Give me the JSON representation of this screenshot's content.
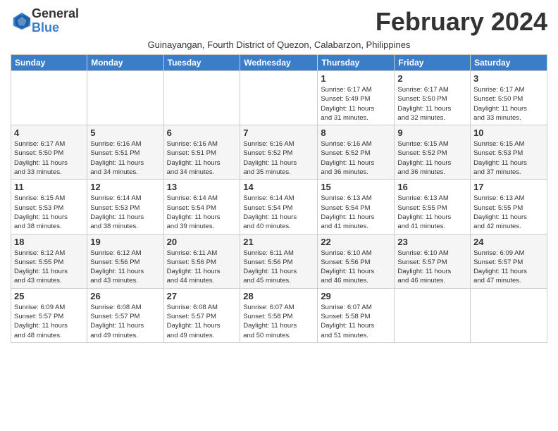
{
  "logo": {
    "general": "General",
    "blue": "Blue"
  },
  "title": "February 2024",
  "subtitle": "Guinayangan, Fourth District of Quezon, Calabarzon, Philippines",
  "days_of_week": [
    "Sunday",
    "Monday",
    "Tuesday",
    "Wednesday",
    "Thursday",
    "Friday",
    "Saturday"
  ],
  "weeks": [
    [
      {
        "day": "",
        "info": ""
      },
      {
        "day": "",
        "info": ""
      },
      {
        "day": "",
        "info": ""
      },
      {
        "day": "",
        "info": ""
      },
      {
        "day": "1",
        "info": "Sunrise: 6:17 AM\nSunset: 5:49 PM\nDaylight: 11 hours\nand 31 minutes."
      },
      {
        "day": "2",
        "info": "Sunrise: 6:17 AM\nSunset: 5:50 PM\nDaylight: 11 hours\nand 32 minutes."
      },
      {
        "day": "3",
        "info": "Sunrise: 6:17 AM\nSunset: 5:50 PM\nDaylight: 11 hours\nand 33 minutes."
      }
    ],
    [
      {
        "day": "4",
        "info": "Sunrise: 6:17 AM\nSunset: 5:50 PM\nDaylight: 11 hours\nand 33 minutes."
      },
      {
        "day": "5",
        "info": "Sunrise: 6:16 AM\nSunset: 5:51 PM\nDaylight: 11 hours\nand 34 minutes."
      },
      {
        "day": "6",
        "info": "Sunrise: 6:16 AM\nSunset: 5:51 PM\nDaylight: 11 hours\nand 34 minutes."
      },
      {
        "day": "7",
        "info": "Sunrise: 6:16 AM\nSunset: 5:52 PM\nDaylight: 11 hours\nand 35 minutes."
      },
      {
        "day": "8",
        "info": "Sunrise: 6:16 AM\nSunset: 5:52 PM\nDaylight: 11 hours\nand 36 minutes."
      },
      {
        "day": "9",
        "info": "Sunrise: 6:15 AM\nSunset: 5:52 PM\nDaylight: 11 hours\nand 36 minutes."
      },
      {
        "day": "10",
        "info": "Sunrise: 6:15 AM\nSunset: 5:53 PM\nDaylight: 11 hours\nand 37 minutes."
      }
    ],
    [
      {
        "day": "11",
        "info": "Sunrise: 6:15 AM\nSunset: 5:53 PM\nDaylight: 11 hours\nand 38 minutes."
      },
      {
        "day": "12",
        "info": "Sunrise: 6:14 AM\nSunset: 5:53 PM\nDaylight: 11 hours\nand 38 minutes."
      },
      {
        "day": "13",
        "info": "Sunrise: 6:14 AM\nSunset: 5:54 PM\nDaylight: 11 hours\nand 39 minutes."
      },
      {
        "day": "14",
        "info": "Sunrise: 6:14 AM\nSunset: 5:54 PM\nDaylight: 11 hours\nand 40 minutes."
      },
      {
        "day": "15",
        "info": "Sunrise: 6:13 AM\nSunset: 5:54 PM\nDaylight: 11 hours\nand 41 minutes."
      },
      {
        "day": "16",
        "info": "Sunrise: 6:13 AM\nSunset: 5:55 PM\nDaylight: 11 hours\nand 41 minutes."
      },
      {
        "day": "17",
        "info": "Sunrise: 6:13 AM\nSunset: 5:55 PM\nDaylight: 11 hours\nand 42 minutes."
      }
    ],
    [
      {
        "day": "18",
        "info": "Sunrise: 6:12 AM\nSunset: 5:55 PM\nDaylight: 11 hours\nand 43 minutes."
      },
      {
        "day": "19",
        "info": "Sunrise: 6:12 AM\nSunset: 5:56 PM\nDaylight: 11 hours\nand 43 minutes."
      },
      {
        "day": "20",
        "info": "Sunrise: 6:11 AM\nSunset: 5:56 PM\nDaylight: 11 hours\nand 44 minutes."
      },
      {
        "day": "21",
        "info": "Sunrise: 6:11 AM\nSunset: 5:56 PM\nDaylight: 11 hours\nand 45 minutes."
      },
      {
        "day": "22",
        "info": "Sunrise: 6:10 AM\nSunset: 5:56 PM\nDaylight: 11 hours\nand 46 minutes."
      },
      {
        "day": "23",
        "info": "Sunrise: 6:10 AM\nSunset: 5:57 PM\nDaylight: 11 hours\nand 46 minutes."
      },
      {
        "day": "24",
        "info": "Sunrise: 6:09 AM\nSunset: 5:57 PM\nDaylight: 11 hours\nand 47 minutes."
      }
    ],
    [
      {
        "day": "25",
        "info": "Sunrise: 6:09 AM\nSunset: 5:57 PM\nDaylight: 11 hours\nand 48 minutes."
      },
      {
        "day": "26",
        "info": "Sunrise: 6:08 AM\nSunset: 5:57 PM\nDaylight: 11 hours\nand 49 minutes."
      },
      {
        "day": "27",
        "info": "Sunrise: 6:08 AM\nSunset: 5:57 PM\nDaylight: 11 hours\nand 49 minutes."
      },
      {
        "day": "28",
        "info": "Sunrise: 6:07 AM\nSunset: 5:58 PM\nDaylight: 11 hours\nand 50 minutes."
      },
      {
        "day": "29",
        "info": "Sunrise: 6:07 AM\nSunset: 5:58 PM\nDaylight: 11 hours\nand 51 minutes."
      },
      {
        "day": "",
        "info": ""
      },
      {
        "day": "",
        "info": ""
      }
    ]
  ]
}
